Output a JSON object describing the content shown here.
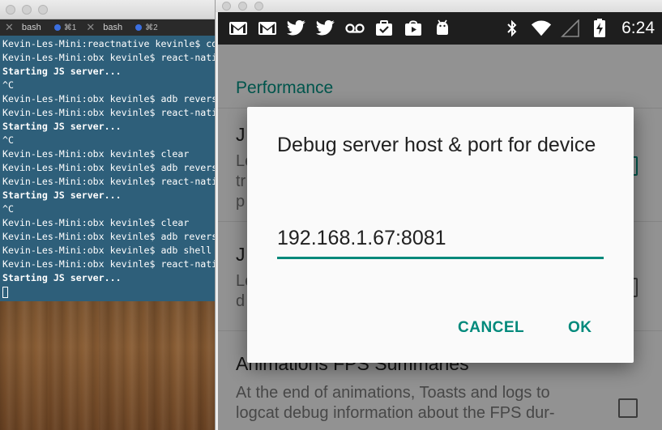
{
  "terminal": {
    "tabs": [
      {
        "name": "bash",
        "shortcut": "⌘1"
      },
      {
        "name": "bash",
        "shortcut": "⌘2"
      }
    ],
    "lines": [
      {
        "text": "Kevin-Les-Mini:reactnative kevinle$ cd",
        "bold": false
      },
      {
        "text": "Kevin-Les-Mini:obx kevinle$ react-nati",
        "bold": false
      },
      {
        "text": "Starting JS server...",
        "bold": true
      },
      {
        "text": "^C",
        "bold": false
      },
      {
        "text": "Kevin-Les-Mini:obx kevinle$ adb revers",
        "bold": false
      },
      {
        "text": "Kevin-Les-Mini:obx kevinle$ react-nati",
        "bold": false
      },
      {
        "text": "Starting JS server...",
        "bold": true
      },
      {
        "text": "^C",
        "bold": false
      },
      {
        "text": "Kevin-Les-Mini:obx kevinle$ clear",
        "bold": false
      },
      {
        "text": "Kevin-Les-Mini:obx kevinle$ adb revers",
        "bold": false
      },
      {
        "text": "Kevin-Les-Mini:obx kevinle$ react-nati",
        "bold": false
      },
      {
        "text": "Starting JS server...",
        "bold": true
      },
      {
        "text": "^C",
        "bold": false
      },
      {
        "text": "Kevin-Les-Mini:obx kevinle$ clear",
        "bold": false
      },
      {
        "text": "Kevin-Les-Mini:obx kevinle$ adb revers",
        "bold": false
      },
      {
        "text": "Kevin-Les-Mini:obx kevinle$ adb shell",
        "bold": false
      },
      {
        "text": "Kevin-Les-Mini:obx kevinle$ react-nati",
        "bold": false
      },
      {
        "text": "Starting JS server...",
        "bold": true
      }
    ]
  },
  "statusbar": {
    "left_icons": [
      "gmail-icon",
      "gmail-icon",
      "twitter-icon",
      "twitter-icon",
      "voicemail-icon",
      "task-done-icon",
      "play-store-icon",
      "android-icon"
    ],
    "right_icons": [
      "bluetooth-icon",
      "wifi-icon",
      "cell-signal-icon",
      "battery-charging-icon"
    ],
    "time": "6:24"
  },
  "settings": {
    "section_title": "Performance",
    "items": [
      {
        "title": "J",
        "summary": "Le\ntr\np",
        "checked": true
      },
      {
        "title": "J",
        "summary": "Le\nd",
        "checked": false
      },
      {
        "title": "Animations FPS Summaries",
        "summary": "At the end of animations, Toasts and logs to\nlogcat debug information about the FPS dur-",
        "checked": false
      }
    ]
  },
  "dialog": {
    "title": "Debug server host & port for device",
    "input_value": "192.168.1.67:8081",
    "cancel_label": "CANCEL",
    "ok_label": "OK"
  },
  "colors": {
    "accent": "#00897b",
    "terminal_bg": "#2e5f7a",
    "statusbar_bg": "#1e1e1e"
  }
}
